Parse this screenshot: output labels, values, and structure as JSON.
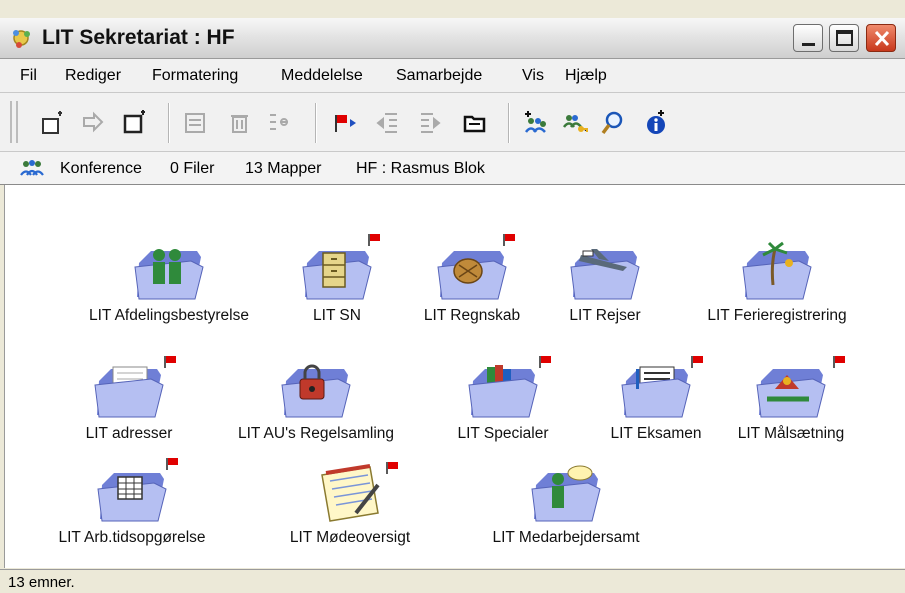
{
  "window": {
    "title": "LIT Sekretariat : HF"
  },
  "colors": {
    "folder_light": "#b5bff2",
    "folder_dark": "#6f7fd6",
    "flag_red": "#e00000",
    "titlebar_close": "#d2492a"
  },
  "menu": {
    "items": [
      "Fil",
      "Rediger",
      "Formatering",
      "Meddelelse",
      "Samarbejde",
      "Vis",
      "Hjælp"
    ]
  },
  "toolbar": {
    "icons": [
      "new-document-icon",
      "forward-icon",
      "new-folder-icon",
      "properties-icon",
      "delete-icon",
      "arrange-icon",
      "red-flag-next-icon",
      "indent-icon",
      "outdent-icon",
      "folder-open-icon",
      "add-users-icon",
      "users-key-icon",
      "search-icon",
      "info-icon"
    ]
  },
  "crumb": {
    "type": "Konference",
    "files": "0 Filer",
    "folders": "13 Mapper",
    "owner": "HF : Rasmus Blok"
  },
  "items": [
    {
      "label": "LIT Afdelingsbestyrelse",
      "icon": "people-folder-icon",
      "flag": false
    },
    {
      "label": "LIT SN",
      "icon": "cabinet-folder-icon",
      "flag": true
    },
    {
      "label": "LIT Regnskab",
      "icon": "money-folder-icon",
      "flag": true
    },
    {
      "label": "LIT Rejser",
      "icon": "travel-folder-icon",
      "flag": false
    },
    {
      "label": "LIT Ferieregistrering",
      "icon": "vacation-folder-icon",
      "flag": false
    },
    {
      "label": "LIT adresser",
      "icon": "addresses-folder-icon",
      "flag": true
    },
    {
      "label": "LIT AU's Regelsamling",
      "icon": "rules-folder-icon",
      "flag": false
    },
    {
      "label": "LIT Specialer",
      "icon": "books-folder-icon",
      "flag": true
    },
    {
      "label": "LIT Eksamen",
      "icon": "exam-folder-icon",
      "flag": true
    },
    {
      "label": "LIT Målsætning",
      "icon": "goals-folder-icon",
      "flag": true
    },
    {
      "label": "LIT Arb.tidsopgørelse",
      "icon": "calendar-folder-icon",
      "flag": true
    },
    {
      "label": "LIT Mødeoversigt",
      "icon": "notepad-icon",
      "flag": true
    },
    {
      "label": "LIT Medarbejdersamt",
      "icon": "chat-person-folder-icon",
      "flag": false
    }
  ],
  "status": {
    "text": "13 emner."
  }
}
